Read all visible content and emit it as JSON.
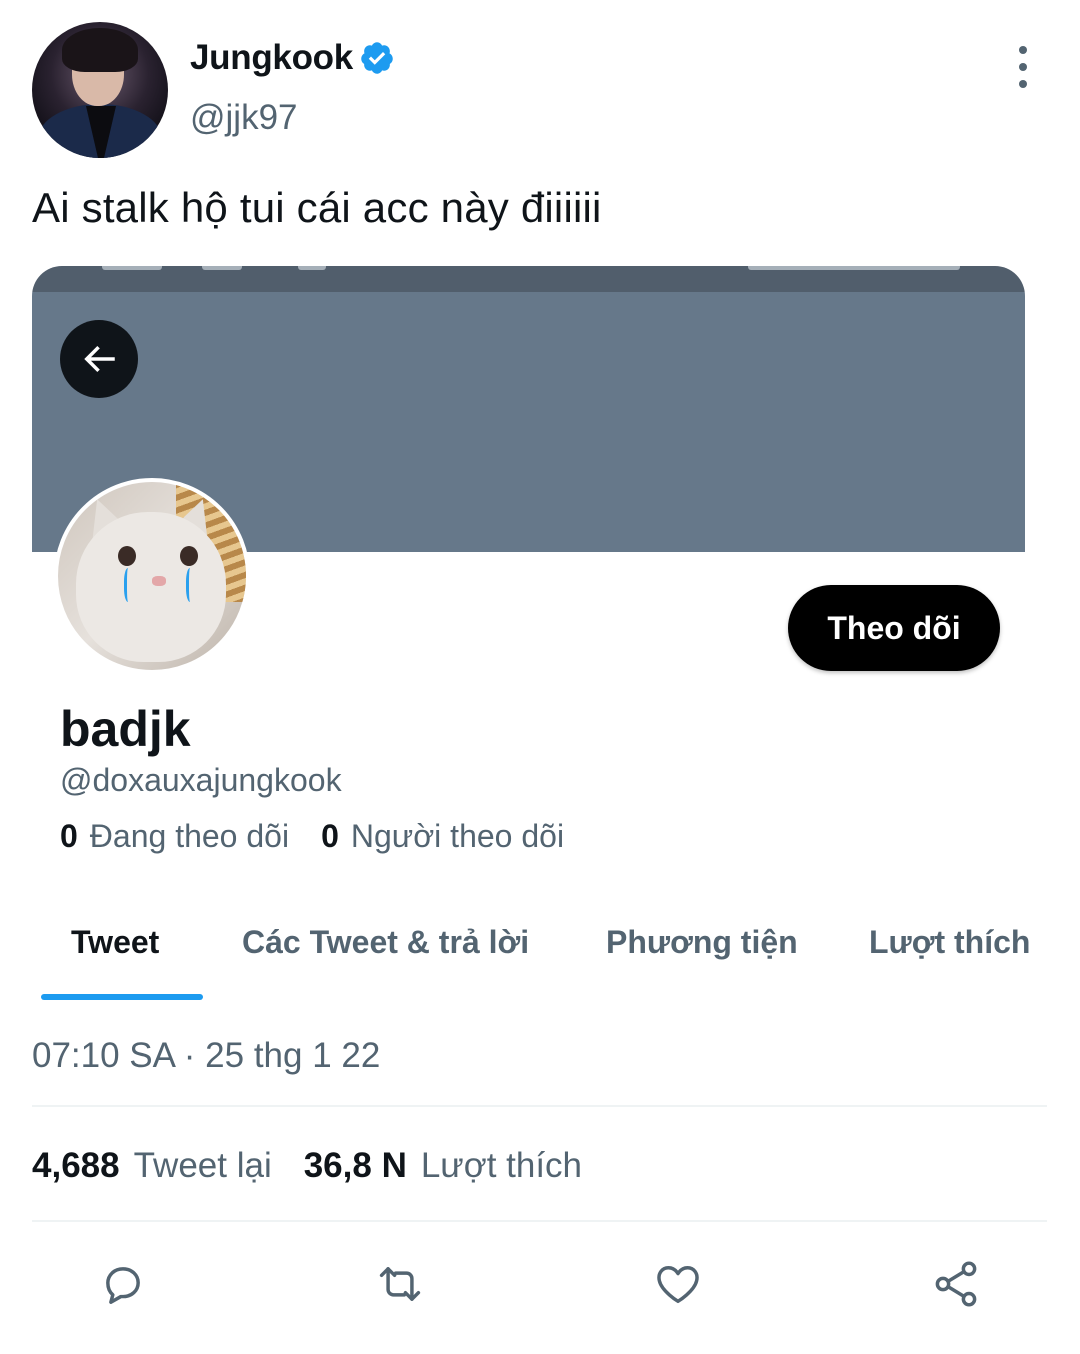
{
  "author": {
    "display_name": "Jungkook",
    "handle": "@jjk97",
    "verified": true
  },
  "tweet": {
    "text": "Ai stalk hộ tui cái acc này điiiiii",
    "timestamp": "07:10 SA · 25 thg 1 22",
    "retweets_count": "4,688",
    "retweets_label": "Tweet lại",
    "likes_count": "36,8 N",
    "likes_label": "Lượt thích"
  },
  "embedded_profile": {
    "follow_label": "Theo dõi",
    "name": "badjk",
    "handle": "@doxauxajungkook",
    "following_count": "0",
    "following_label": "Đang theo dõi",
    "followers_count": "0",
    "followers_label": "Người theo dõi",
    "tabs": [
      {
        "label": "Tweet"
      },
      {
        "label": "Các Tweet & trả lời"
      },
      {
        "label": "Phương tiện"
      },
      {
        "label": "Lượt thích"
      }
    ]
  },
  "icons": {
    "more": "more-vertical-icon",
    "verified": "verified-badge-icon",
    "back": "arrow-left-icon",
    "reply": "reply-icon",
    "retweet": "retweet-icon",
    "like": "heart-icon",
    "share": "share-icon"
  },
  "colors": {
    "accent": "#1d9bf0",
    "banner": "#66788a",
    "text_primary": "#0f1419",
    "text_secondary": "#536471"
  }
}
